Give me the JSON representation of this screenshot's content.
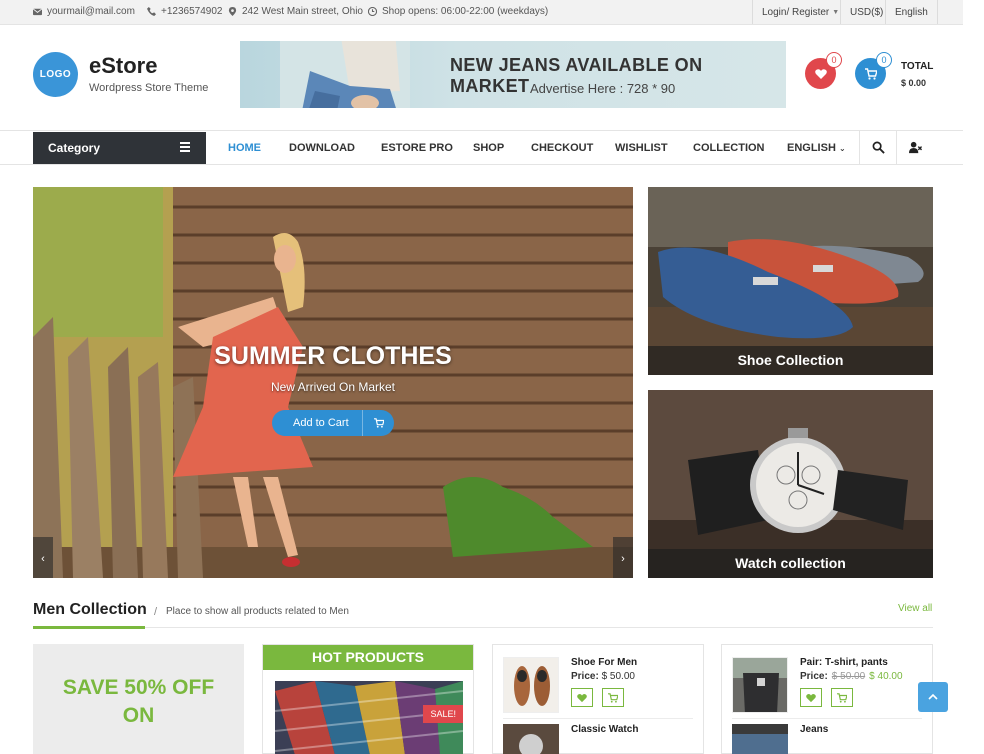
{
  "topbar": {
    "email": "yourmail@mail.com",
    "phone": "+1236574902",
    "address": "242 West Main street, Ohio",
    "hours": "Shop opens: 06:00-22:00 (weekdays)",
    "login": "Login/ Register",
    "currency": "USD($)",
    "language": "English"
  },
  "header": {
    "logo": "LOGO",
    "title": "eStore",
    "tagline": "Wordpress Store Theme",
    "banner_line1": "NEW JEANS AVAILABLE ON MARKET",
    "banner_line2": "Advertise Here : 728 * 90",
    "wishlist_count": "0",
    "cart_count": "0",
    "total_label": "TOTAL",
    "total_value": "$ 0.00"
  },
  "nav": {
    "category": "Category",
    "items": [
      "HOME",
      "DOWNLOAD",
      "ESTORE PRO",
      "SHOP",
      "CHECKOUT",
      "WISHLIST",
      "COLLECTION",
      "ENGLISH"
    ]
  },
  "hero": {
    "title": "SUMMER CLOTHES",
    "subtitle": "New Arrived On Market",
    "button": "Add to Cart"
  },
  "promos": {
    "shoes": "Shoe Collection",
    "watch": "Watch collection"
  },
  "section": {
    "title": "Men Collection",
    "separator": "/",
    "description": "Place to show all products related to Men",
    "view_all": "View all"
  },
  "save_box": {
    "line1": "SAVE 50% OFF",
    "line2": "ON"
  },
  "hot": {
    "title": "HOT PRODUCTS",
    "sale": "SALE!"
  },
  "products": [
    {
      "name": "Shoe For Men",
      "price_label": "Price:",
      "price": "$ 50.00"
    },
    {
      "name": "Classic Watch"
    },
    {
      "name": "Pair: T-shirt, pants",
      "price_label": "Price:",
      "old_price": "$ 50.00",
      "new_price": "$ 40.00"
    },
    {
      "name": "Jeans"
    }
  ],
  "colors": {
    "accent_blue": "#2e8fd3",
    "accent_green": "#7ab83e",
    "wish_red": "#e0474c",
    "dark": "#2f3338"
  }
}
